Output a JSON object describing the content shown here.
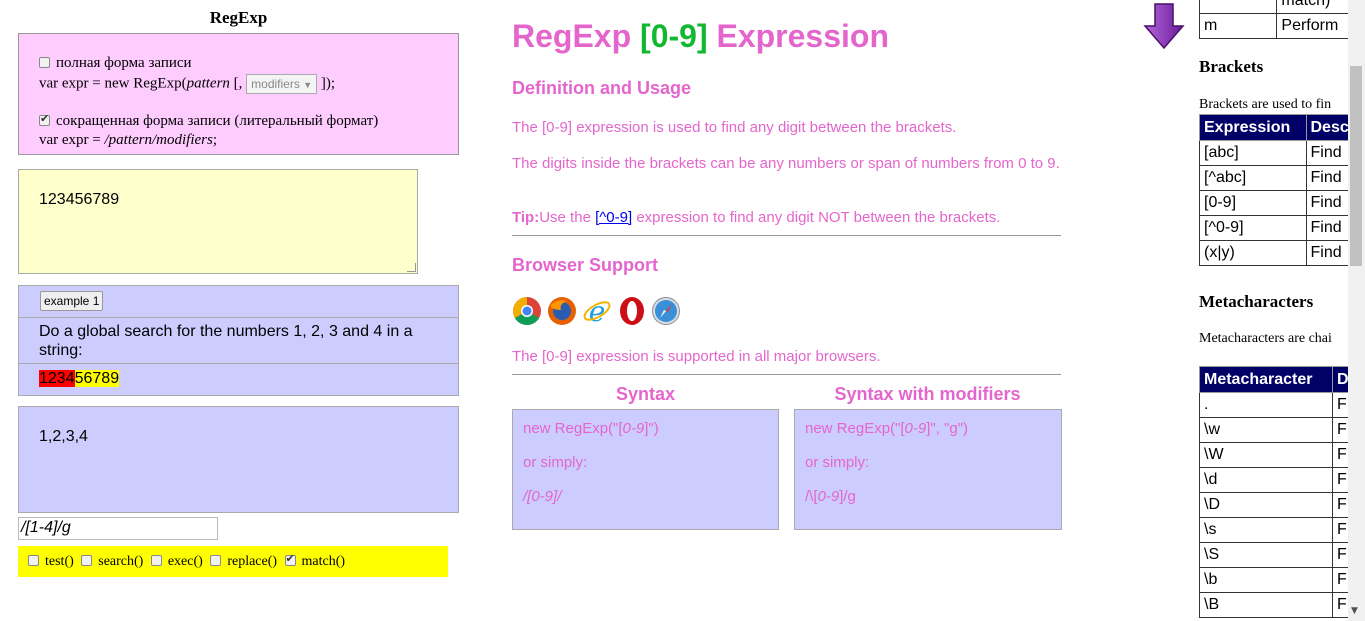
{
  "left": {
    "title": "RegExp",
    "full_form_label": "полная форма записи",
    "full_form_code_prefix": "var expr = new RegExp(",
    "full_form_code_pattern": "pattern",
    "full_form_code_mid": " [, ",
    "modifiers_select": "modifiers",
    "full_form_code_suffix": " ]);",
    "short_form_label": "сокращенная форма записи (литеральный формат)",
    "short_form_code_prefix": "var expr = ",
    "short_form_code_italic": "/pattern/modifiers",
    "short_form_code_suffix": ";",
    "textarea_value": "123456789",
    "example_button": "example 1",
    "example_description": "Do a global search for the numbers 1, 2, 3 and 4 in a string:",
    "result_highlight_match": "1234",
    "result_highlight_rest": "56789",
    "output_value": "1,2,3,4",
    "regex_input_value": "/[1-4]/g",
    "methods": [
      {
        "label": "test()",
        "checked": false
      },
      {
        "label": "search()",
        "checked": false
      },
      {
        "label": "exec()",
        "checked": false
      },
      {
        "label": "replace()",
        "checked": false
      },
      {
        "label": "match()",
        "checked": true
      }
    ]
  },
  "main": {
    "title_prefix": "RegExp ",
    "title_green": "[0-9]",
    "title_suffix": " Expression",
    "definition_heading": "Definition and Usage",
    "definition_p1": "The [0-9] expression is used to find any digit between the brackets.",
    "definition_p2": "The digits inside the brackets can be any numbers or span of numbers from 0 to 9.",
    "tip_label": "Tip:",
    "tip_text_before": "Use the ",
    "tip_link": "[^0-9]",
    "tip_text_after": " expression to find any digit NOT between the brackets.",
    "browser_heading": "Browser Support",
    "browser_icons": [
      "chrome-icon",
      "firefox-icon",
      "ie-icon",
      "opera-icon",
      "safari-icon"
    ],
    "browser_support_text": "The [0-9] expression is supported in all major browsers.",
    "syntax_heading": "Syntax",
    "syntax_modifiers_heading": "Syntax with modifiers",
    "syntax_line1_prefix": "new RegExp(\"[",
    "syntax_line1_italic": "0-9",
    "syntax_line1_suffix": "]\")",
    "syntax_or": "or simply:",
    "syntax_line2_prefix": "/[",
    "syntax_line2_italic": "0-9",
    "syntax_line2_suffix": "]/",
    "syntax_mod_line1_prefix": "new RegExp(\"[",
    "syntax_mod_line1_italic": "0-9",
    "syntax_mod_line1_suffix": "]\", \"g\")",
    "syntax_mod_line2_prefix": "/\\[",
    "syntax_mod_line2_italic": "0-9",
    "syntax_mod_line2_suffix": "]/g"
  },
  "right": {
    "top_table_rows": [
      {
        "c1": "",
        "c2": "match)"
      },
      {
        "c1": "m",
        "c2": "Perform"
      }
    ],
    "brackets_heading": "Brackets",
    "brackets_text": "Brackets are used to fin",
    "brackets_headers": [
      "Expression",
      "Desc"
    ],
    "brackets_rows": [
      {
        "c1": "[abc]",
        "c2": "Find"
      },
      {
        "c1": "[^abc]",
        "c2": "Find"
      },
      {
        "c1": "[0-9]",
        "c2": "Find"
      },
      {
        "c1": "[^0-9]",
        "c2": "Find"
      },
      {
        "c1": "(x|y)",
        "c2": "Find"
      }
    ],
    "meta_heading": "Metacharacters",
    "meta_text": "Metacharacters are chai",
    "meta_headers": [
      "Metacharacter",
      "D"
    ],
    "meta_rows": [
      {
        "c1": ".",
        "c2": "F"
      },
      {
        "c1": "\\w",
        "c2": "F"
      },
      {
        "c1": "\\W",
        "c2": "F"
      },
      {
        "c1": "\\d",
        "c2": "F"
      },
      {
        "c1": "\\D",
        "c2": "F"
      },
      {
        "c1": "\\s",
        "c2": "F"
      },
      {
        "c1": "\\S",
        "c2": "F"
      },
      {
        "c1": "\\b",
        "c2": "F"
      },
      {
        "c1": "\\B",
        "c2": "F"
      }
    ]
  },
  "colors": {
    "pink": "#e466cd",
    "green": "#12b830",
    "table_header": "#000066",
    "lilac": "#ccccff",
    "form_pink": "#ffccff",
    "textarea_yellow": "#ffffcc",
    "methods_yellow": "#ffff00",
    "match_red": "#ff0000"
  }
}
